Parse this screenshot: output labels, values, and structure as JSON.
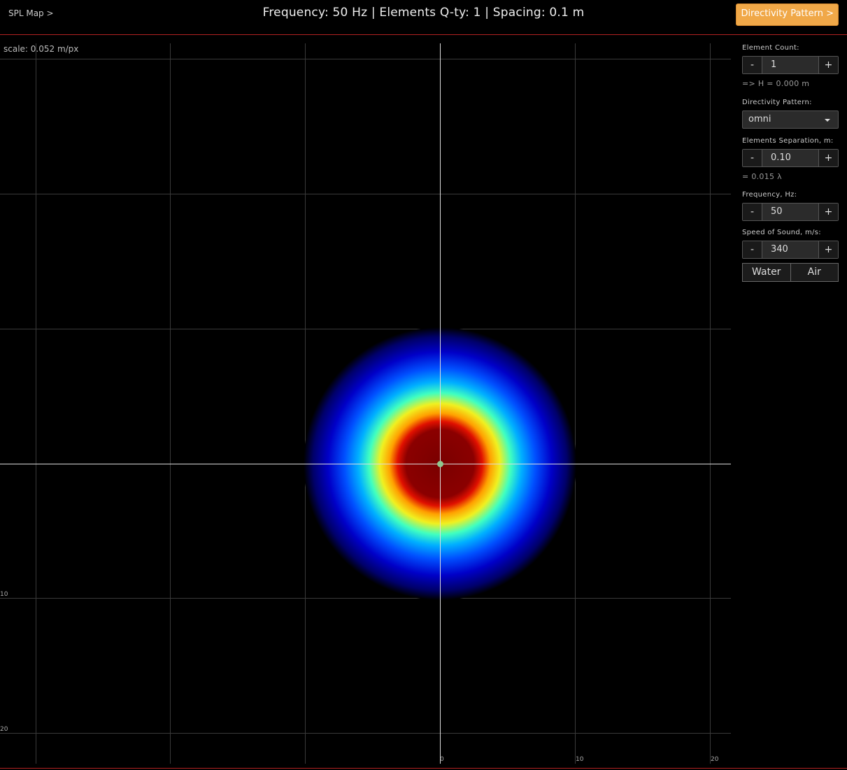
{
  "topbar": {
    "nav_left": "SPL Map >",
    "title": "Frequency: 50 Hz | Elements Q-ty: 1 | Spacing: 0.1 m",
    "nav_right": "Directivity Pattern >"
  },
  "map": {
    "scale_label": "scale: 0.052 m/px",
    "x_ticks": [
      "0",
      "10",
      "20"
    ],
    "y_ticks": [
      "10",
      "20"
    ],
    "colormap": "jet",
    "source_color": "#90c890"
  },
  "panel": {
    "element_count": {
      "label": "Element Count:",
      "value": "1",
      "minus": "-",
      "plus": "+",
      "derived": "=> H = 0.000 m"
    },
    "directivity": {
      "label": "Directivity Pattern:",
      "value": "omni"
    },
    "separation": {
      "label": "Elements Separation, m:",
      "value": "0.10",
      "minus": "-",
      "plus": "+",
      "derived": "= 0.015 λ"
    },
    "frequency": {
      "label": "Frequency, Hz:",
      "value": "50",
      "minus": "-",
      "plus": "+"
    },
    "speed": {
      "label": "Speed of Sound, m/s:",
      "value": "340",
      "minus": "-",
      "plus": "+"
    },
    "medium": {
      "water": "Water",
      "air": "Air"
    }
  },
  "colors": {
    "accent": "#f0a848",
    "divider": "#b22222"
  }
}
